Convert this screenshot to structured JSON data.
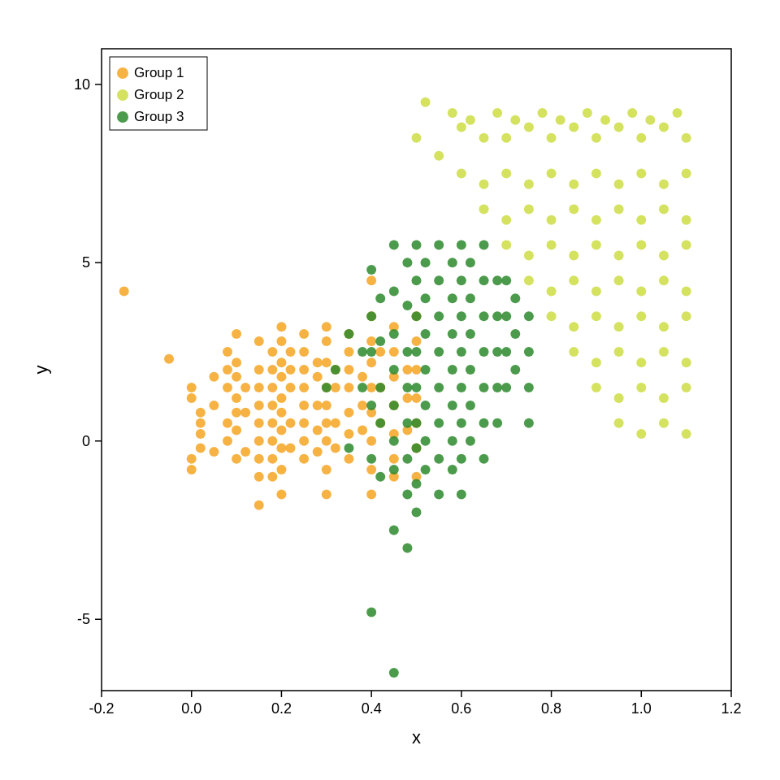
{
  "chart": {
    "title": "",
    "xLabel": "x",
    "yLabel": "y",
    "xMin": -0.2,
    "xMax": 1.2,
    "yMin": -7,
    "yMax": 11,
    "xTicks": [
      -0.2,
      0.0,
      0.2,
      0.4,
      0.6,
      0.8,
      1.0,
      1.2
    ],
    "yTicks": [
      -5,
      0,
      5,
      10
    ],
    "legend": [
      {
        "label": "Group 1",
        "color": "#F5A623"
      },
      {
        "label": "Group 2",
        "color": "#CCDD44"
      },
      {
        "label": "Group 3",
        "color": "#2D8A2D"
      }
    ]
  },
  "groups": {
    "group1": {
      "color": "#F5A623",
      "points": [
        [
          -0.15,
          4.2
        ],
        [
          -0.05,
          2.3
        ],
        [
          0.0,
          1.5
        ],
        [
          0.0,
          1.2
        ],
        [
          0.02,
          0.8
        ],
        [
          0.02,
          0.5
        ],
        [
          0.02,
          0.2
        ],
        [
          0.02,
          -0.2
        ],
        [
          0.0,
          -0.5
        ],
        [
          0.0,
          -0.8
        ],
        [
          0.05,
          1.8
        ],
        [
          0.05,
          1.0
        ],
        [
          0.05,
          -0.3
        ],
        [
          0.08,
          2.5
        ],
        [
          0.08,
          2.0
        ],
        [
          0.08,
          1.5
        ],
        [
          0.08,
          0.5
        ],
        [
          0.08,
          0.0
        ],
        [
          0.1,
          3.0
        ],
        [
          0.1,
          2.2
        ],
        [
          0.1,
          1.8
        ],
        [
          0.1,
          1.2
        ],
        [
          0.1,
          0.8
        ],
        [
          0.1,
          0.3
        ],
        [
          0.1,
          -0.5
        ],
        [
          0.12,
          1.5
        ],
        [
          0.12,
          0.8
        ],
        [
          0.12,
          -0.3
        ],
        [
          0.15,
          2.8
        ],
        [
          0.15,
          2.0
        ],
        [
          0.15,
          1.5
        ],
        [
          0.15,
          1.0
        ],
        [
          0.15,
          0.5
        ],
        [
          0.15,
          0.0
        ],
        [
          0.15,
          -0.5
        ],
        [
          0.15,
          -1.0
        ],
        [
          0.15,
          -1.8
        ],
        [
          0.18,
          2.5
        ],
        [
          0.18,
          2.0
        ],
        [
          0.18,
          1.5
        ],
        [
          0.18,
          1.0
        ],
        [
          0.18,
          0.5
        ],
        [
          0.18,
          0.0
        ],
        [
          0.18,
          -0.5
        ],
        [
          0.18,
          -1.0
        ],
        [
          0.2,
          3.2
        ],
        [
          0.2,
          2.8
        ],
        [
          0.2,
          2.2
        ],
        [
          0.2,
          1.8
        ],
        [
          0.2,
          1.2
        ],
        [
          0.2,
          0.8
        ],
        [
          0.2,
          0.3
        ],
        [
          0.2,
          -0.2
        ],
        [
          0.2,
          -0.8
        ],
        [
          0.2,
          -1.5
        ],
        [
          0.22,
          2.5
        ],
        [
          0.22,
          2.0
        ],
        [
          0.22,
          1.5
        ],
        [
          0.22,
          0.5
        ],
        [
          0.22,
          -0.2
        ],
        [
          0.25,
          3.0
        ],
        [
          0.25,
          2.5
        ],
        [
          0.25,
          2.0
        ],
        [
          0.25,
          1.5
        ],
        [
          0.25,
          1.0
        ],
        [
          0.25,
          0.5
        ],
        [
          0.25,
          0.0
        ],
        [
          0.25,
          -0.5
        ],
        [
          0.28,
          2.2
        ],
        [
          0.28,
          1.8
        ],
        [
          0.28,
          1.0
        ],
        [
          0.28,
          0.3
        ],
        [
          0.28,
          -0.3
        ],
        [
          0.3,
          3.2
        ],
        [
          0.3,
          2.8
        ],
        [
          0.3,
          2.2
        ],
        [
          0.3,
          1.5
        ],
        [
          0.3,
          1.0
        ],
        [
          0.3,
          0.5
        ],
        [
          0.3,
          0.0
        ],
        [
          0.3,
          -0.8
        ],
        [
          0.3,
          -1.5
        ],
        [
          0.32,
          2.0
        ],
        [
          0.32,
          1.5
        ],
        [
          0.32,
          0.5
        ],
        [
          0.32,
          -0.2
        ],
        [
          0.35,
          3.0
        ],
        [
          0.35,
          2.5
        ],
        [
          0.35,
          2.0
        ],
        [
          0.35,
          1.5
        ],
        [
          0.35,
          0.8
        ],
        [
          0.35,
          0.2
        ],
        [
          0.35,
          -0.5
        ],
        [
          0.38,
          1.8
        ],
        [
          0.38,
          1.0
        ],
        [
          0.38,
          0.3
        ],
        [
          0.4,
          4.5
        ],
        [
          0.4,
          3.5
        ],
        [
          0.4,
          2.8
        ],
        [
          0.4,
          2.2
        ],
        [
          0.4,
          1.5
        ],
        [
          0.4,
          0.8
        ],
        [
          0.4,
          0.0
        ],
        [
          0.4,
          -0.8
        ],
        [
          0.4,
          -1.5
        ],
        [
          0.42,
          2.5
        ],
        [
          0.42,
          1.5
        ],
        [
          0.42,
          0.5
        ],
        [
          0.45,
          3.2
        ],
        [
          0.45,
          2.5
        ],
        [
          0.45,
          1.8
        ],
        [
          0.45,
          1.0
        ],
        [
          0.45,
          0.2
        ],
        [
          0.45,
          -0.5
        ],
        [
          0.45,
          -1.0
        ],
        [
          0.48,
          2.0
        ],
        [
          0.48,
          1.2
        ],
        [
          0.48,
          0.3
        ],
        [
          0.5,
          3.5
        ],
        [
          0.5,
          2.8
        ],
        [
          0.5,
          2.0
        ],
        [
          0.5,
          1.2
        ],
        [
          0.5,
          0.5
        ],
        [
          0.5,
          -0.2
        ],
        [
          0.5,
          -1.0
        ]
      ]
    },
    "group2": {
      "color": "#CCDD44",
      "points": [
        [
          0.5,
          8.5
        ],
        [
          0.52,
          9.5
        ],
        [
          0.55,
          8.0
        ],
        [
          0.58,
          9.2
        ],
        [
          0.6,
          8.8
        ],
        [
          0.62,
          9.0
        ],
        [
          0.65,
          8.5
        ],
        [
          0.68,
          9.2
        ],
        [
          0.7,
          8.5
        ],
        [
          0.72,
          9.0
        ],
        [
          0.75,
          8.8
        ],
        [
          0.78,
          9.2
        ],
        [
          0.8,
          8.5
        ],
        [
          0.82,
          9.0
        ],
        [
          0.85,
          8.8
        ],
        [
          0.88,
          9.2
        ],
        [
          0.9,
          8.5
        ],
        [
          0.92,
          9.0
        ],
        [
          0.95,
          8.8
        ],
        [
          0.98,
          9.2
        ],
        [
          1.0,
          8.5
        ],
        [
          1.02,
          9.0
        ],
        [
          1.05,
          8.8
        ],
        [
          1.08,
          9.2
        ],
        [
          1.1,
          8.5
        ],
        [
          0.6,
          7.5
        ],
        [
          0.65,
          7.2
        ],
        [
          0.7,
          7.5
        ],
        [
          0.75,
          7.2
        ],
        [
          0.8,
          7.5
        ],
        [
          0.85,
          7.2
        ],
        [
          0.9,
          7.5
        ],
        [
          0.95,
          7.2
        ],
        [
          1.0,
          7.5
        ],
        [
          1.05,
          7.2
        ],
        [
          1.1,
          7.5
        ],
        [
          0.65,
          6.5
        ],
        [
          0.7,
          6.2
        ],
        [
          0.75,
          6.5
        ],
        [
          0.8,
          6.2
        ],
        [
          0.85,
          6.5
        ],
        [
          0.9,
          6.2
        ],
        [
          0.95,
          6.5
        ],
        [
          1.0,
          6.2
        ],
        [
          1.05,
          6.5
        ],
        [
          1.1,
          6.2
        ],
        [
          0.7,
          5.5
        ],
        [
          0.75,
          5.2
        ],
        [
          0.8,
          5.5
        ],
        [
          0.85,
          5.2
        ],
        [
          0.9,
          5.5
        ],
        [
          0.95,
          5.2
        ],
        [
          1.0,
          5.5
        ],
        [
          1.05,
          5.2
        ],
        [
          1.1,
          5.5
        ],
        [
          0.75,
          4.5
        ],
        [
          0.8,
          4.2
        ],
        [
          0.85,
          4.5
        ],
        [
          0.9,
          4.2
        ],
        [
          0.95,
          4.5
        ],
        [
          1.0,
          4.2
        ],
        [
          1.05,
          4.5
        ],
        [
          1.1,
          4.2
        ],
        [
          0.8,
          3.5
        ],
        [
          0.85,
          3.2
        ],
        [
          0.9,
          3.5
        ],
        [
          0.95,
          3.2
        ],
        [
          1.0,
          3.5
        ],
        [
          1.05,
          3.2
        ],
        [
          1.1,
          3.5
        ],
        [
          0.85,
          2.5
        ],
        [
          0.9,
          2.2
        ],
        [
          0.95,
          2.5
        ],
        [
          1.0,
          2.2
        ],
        [
          1.05,
          2.5
        ],
        [
          1.1,
          2.2
        ],
        [
          0.9,
          1.5
        ],
        [
          0.95,
          1.2
        ],
        [
          1.0,
          1.5
        ],
        [
          1.05,
          1.2
        ],
        [
          1.1,
          1.5
        ],
        [
          0.95,
          0.5
        ],
        [
          1.0,
          0.2
        ],
        [
          1.05,
          0.5
        ],
        [
          1.1,
          0.2
        ]
      ]
    },
    "group3": {
      "color": "#2D8A2D",
      "points": [
        [
          0.3,
          1.5
        ],
        [
          0.32,
          2.0
        ],
        [
          0.35,
          3.0
        ],
        [
          0.35,
          -0.2
        ],
        [
          0.38,
          2.5
        ],
        [
          0.38,
          1.5
        ],
        [
          0.4,
          4.8
        ],
        [
          0.4,
          3.5
        ],
        [
          0.4,
          2.5
        ],
        [
          0.4,
          1.0
        ],
        [
          0.4,
          -0.5
        ],
        [
          0.4,
          -4.8
        ],
        [
          0.42,
          4.0
        ],
        [
          0.42,
          2.8
        ],
        [
          0.42,
          1.5
        ],
        [
          0.42,
          0.5
        ],
        [
          0.42,
          -1.0
        ],
        [
          0.45,
          5.5
        ],
        [
          0.45,
          4.2
        ],
        [
          0.45,
          3.0
        ],
        [
          0.45,
          2.0
        ],
        [
          0.45,
          1.0
        ],
        [
          0.45,
          0.0
        ],
        [
          0.45,
          -0.8
        ],
        [
          0.45,
          -2.5
        ],
        [
          0.45,
          -6.5
        ],
        [
          0.48,
          5.0
        ],
        [
          0.48,
          3.8
        ],
        [
          0.48,
          2.5
        ],
        [
          0.48,
          1.5
        ],
        [
          0.48,
          0.5
        ],
        [
          0.48,
          -0.5
        ],
        [
          0.48,
          -1.5
        ],
        [
          0.48,
          -3.0
        ],
        [
          0.5,
          5.5
        ],
        [
          0.5,
          4.5
        ],
        [
          0.5,
          3.5
        ],
        [
          0.5,
          2.5
        ],
        [
          0.5,
          1.5
        ],
        [
          0.5,
          0.5
        ],
        [
          0.5,
          -0.2
        ],
        [
          0.5,
          -1.2
        ],
        [
          0.5,
          -2.0
        ],
        [
          0.52,
          5.0
        ],
        [
          0.52,
          4.0
        ],
        [
          0.52,
          3.0
        ],
        [
          0.52,
          2.0
        ],
        [
          0.52,
          1.0
        ],
        [
          0.52,
          0.0
        ],
        [
          0.52,
          -0.8
        ],
        [
          0.55,
          5.5
        ],
        [
          0.55,
          4.5
        ],
        [
          0.55,
          3.5
        ],
        [
          0.55,
          2.5
        ],
        [
          0.55,
          1.5
        ],
        [
          0.55,
          0.5
        ],
        [
          0.55,
          -0.5
        ],
        [
          0.55,
          -1.5
        ],
        [
          0.58,
          5.0
        ],
        [
          0.58,
          4.0
        ],
        [
          0.58,
          3.0
        ],
        [
          0.58,
          2.0
        ],
        [
          0.58,
          1.0
        ],
        [
          0.58,
          0.0
        ],
        [
          0.58,
          -0.8
        ],
        [
          0.6,
          5.5
        ],
        [
          0.6,
          4.5
        ],
        [
          0.6,
          3.5
        ],
        [
          0.6,
          2.5
        ],
        [
          0.6,
          1.5
        ],
        [
          0.6,
          0.5
        ],
        [
          0.6,
          -0.5
        ],
        [
          0.6,
          -1.5
        ],
        [
          0.62,
          5.0
        ],
        [
          0.62,
          4.0
        ],
        [
          0.62,
          3.0
        ],
        [
          0.62,
          2.0
        ],
        [
          0.62,
          1.0
        ],
        [
          0.62,
          0.0
        ],
        [
          0.65,
          5.5
        ],
        [
          0.65,
          4.5
        ],
        [
          0.65,
          3.5
        ],
        [
          0.65,
          2.5
        ],
        [
          0.65,
          1.5
        ],
        [
          0.65,
          0.5
        ],
        [
          0.65,
          -0.5
        ],
        [
          0.68,
          4.5
        ],
        [
          0.68,
          3.5
        ],
        [
          0.68,
          2.5
        ],
        [
          0.68,
          1.5
        ],
        [
          0.68,
          0.5
        ],
        [
          0.7,
          4.5
        ],
        [
          0.7,
          3.5
        ],
        [
          0.7,
          2.5
        ],
        [
          0.7,
          1.5
        ],
        [
          0.72,
          4.0
        ],
        [
          0.72,
          3.0
        ],
        [
          0.72,
          2.0
        ],
        [
          0.75,
          3.5
        ],
        [
          0.75,
          2.5
        ],
        [
          0.75,
          1.5
        ],
        [
          0.75,
          0.5
        ]
      ]
    }
  }
}
